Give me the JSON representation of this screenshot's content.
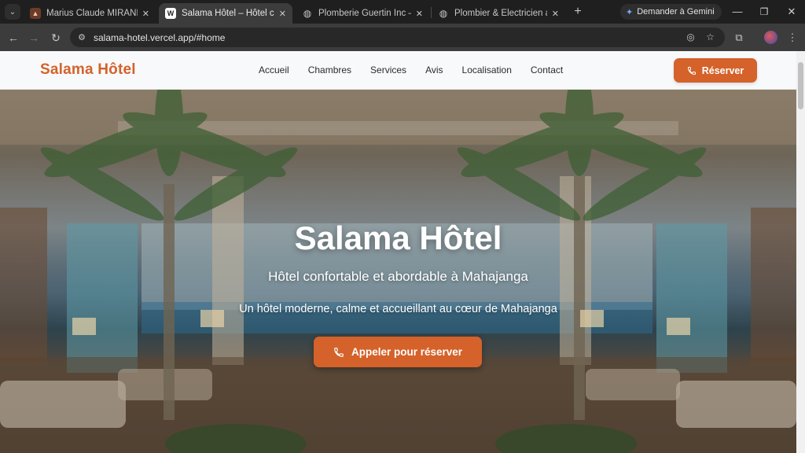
{
  "browser": {
    "tabs": [
      {
        "title": "Marius Claude MIRANIRINA | I",
        "icon": "profile-favicon-icon",
        "active": false
      },
      {
        "title": "Salama Hôtel – Hôtel confortab",
        "icon": "salama-favicon-icon",
        "active": true
      },
      {
        "title": "Plomberie Guertin Inc – Plomb",
        "icon": "globe-icon",
        "active": false
      },
      {
        "title": "Plombier & Electricien a Lalmo",
        "icon": "globe-icon",
        "active": false
      }
    ],
    "gemini_label": "Demander à Gemini",
    "url": "salama-hotel.vercel.app/#home"
  },
  "site": {
    "brand": "Salama Hôtel",
    "nav": [
      "Accueil",
      "Chambres",
      "Services",
      "Avis",
      "Localisation",
      "Contact"
    ],
    "reserve_label": "Réserver",
    "accent_color": "#d4622a"
  },
  "hero": {
    "title": "Salama Hôtel",
    "subtitle": "Hôtel confortable et abordable à Mahajanga",
    "description": "Un hôtel moderne, calme et accueillant au cœur de Mahajanga",
    "cta_label": "Appeler pour réserver"
  }
}
